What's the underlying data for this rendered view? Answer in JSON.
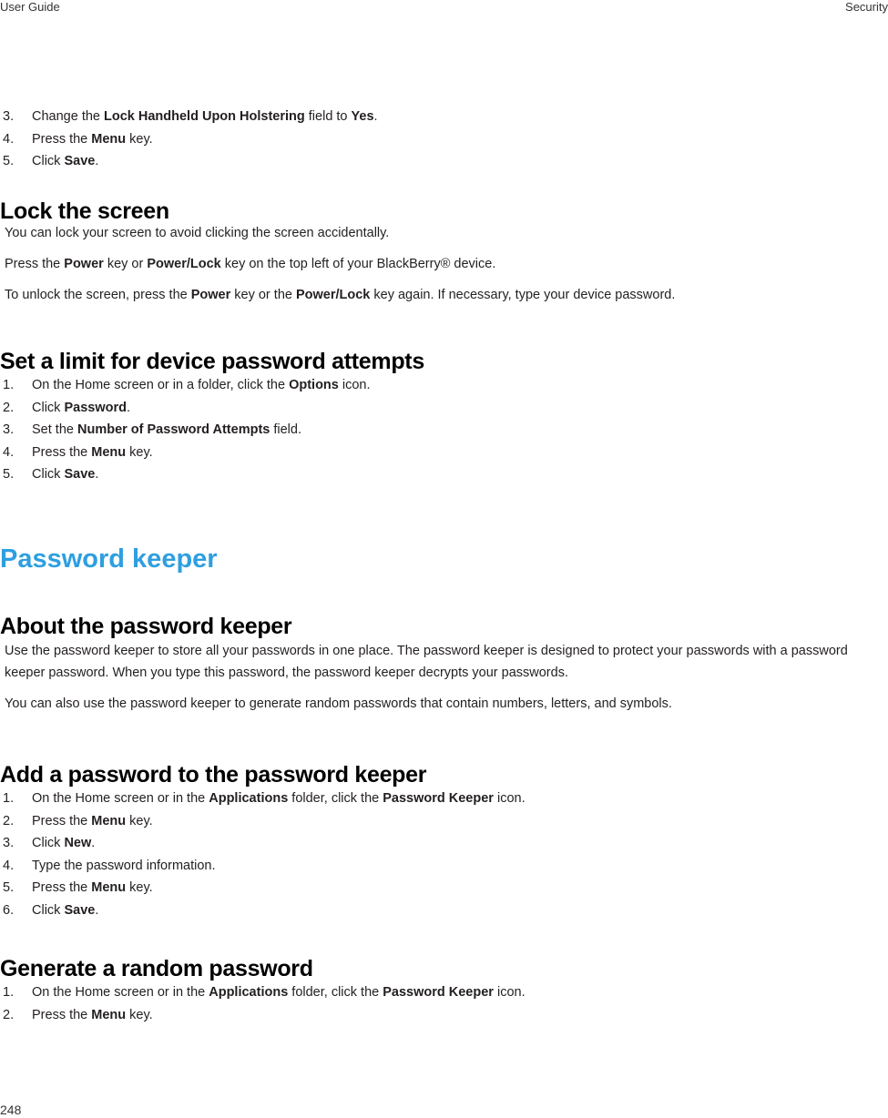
{
  "header": {
    "left": "User Guide",
    "right": "Security"
  },
  "footer": {
    "page_number": "248"
  },
  "colors": {
    "chapter_heading": "#2e9fe0",
    "text": "#231f20"
  },
  "sections": {
    "continued_steps": {
      "steps": [
        {
          "num": "3.",
          "parts": [
            {
              "t": "Change the "
            },
            {
              "b": "Lock Handheld Upon Holstering"
            },
            {
              "t": " field to "
            },
            {
              "b": "Yes"
            },
            {
              "t": "."
            }
          ]
        },
        {
          "num": "4.",
          "parts": [
            {
              "t": "Press the "
            },
            {
              "b": "Menu"
            },
            {
              "t": " key."
            }
          ]
        },
        {
          "num": "5.",
          "parts": [
            {
              "t": "Click "
            },
            {
              "b": "Save"
            },
            {
              "t": "."
            }
          ]
        }
      ]
    },
    "lock_screen": {
      "title": "Lock the screen",
      "paragraphs": [
        [
          {
            "t": "You can lock your screen to avoid clicking the screen accidentally."
          }
        ],
        [
          {
            "t": "Press the "
          },
          {
            "b": "Power"
          },
          {
            "t": " key or "
          },
          {
            "b": "Power/Lock"
          },
          {
            "t": " key on the top left of your BlackBerry® device."
          }
        ],
        [
          {
            "t": "To unlock the screen, press the "
          },
          {
            "b": "Power"
          },
          {
            "t": " key or the "
          },
          {
            "b": "Power/Lock"
          },
          {
            "t": " key again. If necessary, type your device password."
          }
        ]
      ]
    },
    "password_attempts": {
      "title": "Set a limit for device password attempts",
      "steps": [
        {
          "num": "1.",
          "parts": [
            {
              "t": "On the Home screen or in a folder, click the "
            },
            {
              "b": "Options"
            },
            {
              "t": " icon."
            }
          ]
        },
        {
          "num": "2.",
          "parts": [
            {
              "t": "Click "
            },
            {
              "b": "Password"
            },
            {
              "t": "."
            }
          ]
        },
        {
          "num": "3.",
          "parts": [
            {
              "t": "Set the "
            },
            {
              "b": "Number of Password Attempts"
            },
            {
              "t": " field."
            }
          ]
        },
        {
          "num": "4.",
          "parts": [
            {
              "t": "Press the "
            },
            {
              "b": "Menu"
            },
            {
              "t": " key."
            }
          ]
        },
        {
          "num": "5.",
          "parts": [
            {
              "t": "Click "
            },
            {
              "b": "Save"
            },
            {
              "t": "."
            }
          ]
        }
      ]
    },
    "chapter": {
      "title": "Password keeper"
    },
    "about_keeper": {
      "title": "About the password keeper",
      "paragraphs": [
        [
          {
            "t": "Use the password keeper to store all your passwords in one place. The password keeper is designed to protect your passwords with a password keeper password. When you type this password, the password keeper decrypts your passwords."
          }
        ],
        [
          {
            "t": "You can also use the password keeper to generate random passwords that contain numbers, letters, and symbols."
          }
        ]
      ]
    },
    "add_password": {
      "title": "Add a password to the password keeper",
      "steps": [
        {
          "num": "1.",
          "parts": [
            {
              "t": "On the Home screen or in the "
            },
            {
              "b": "Applications"
            },
            {
              "t": " folder, click the "
            },
            {
              "b": "Password Keeper"
            },
            {
              "t": " icon."
            }
          ]
        },
        {
          "num": "2.",
          "parts": [
            {
              "t": "Press the "
            },
            {
              "b": "Menu"
            },
            {
              "t": " key."
            }
          ]
        },
        {
          "num": "3.",
          "parts": [
            {
              "t": "Click "
            },
            {
              "b": "New"
            },
            {
              "t": "."
            }
          ]
        },
        {
          "num": "4.",
          "parts": [
            {
              "t": "Type the password information."
            }
          ]
        },
        {
          "num": "5.",
          "parts": [
            {
              "t": "Press the "
            },
            {
              "b": "Menu"
            },
            {
              "t": " key."
            }
          ]
        },
        {
          "num": "6.",
          "parts": [
            {
              "t": "Click "
            },
            {
              "b": "Save"
            },
            {
              "t": "."
            }
          ]
        }
      ]
    },
    "generate_password": {
      "title": "Generate a random password",
      "steps": [
        {
          "num": "1.",
          "parts": [
            {
              "t": "On the Home screen or in the "
            },
            {
              "b": "Applications"
            },
            {
              "t": " folder, click the "
            },
            {
              "b": "Password Keeper"
            },
            {
              "t": " icon."
            }
          ]
        },
        {
          "num": "2.",
          "parts": [
            {
              "t": "Press the "
            },
            {
              "b": "Menu"
            },
            {
              "t": " key."
            }
          ]
        }
      ]
    }
  }
}
